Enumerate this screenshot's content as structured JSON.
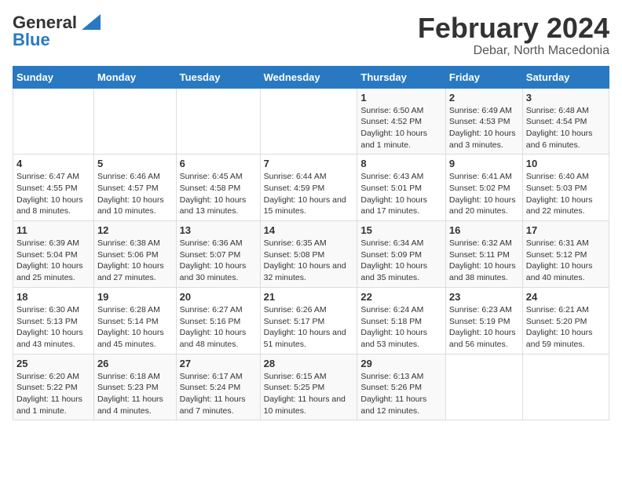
{
  "header": {
    "logo_general": "General",
    "logo_blue": "Blue",
    "main_title": "February 2024",
    "sub_title": "Debar, North Macedonia"
  },
  "calendar": {
    "days_of_week": [
      "Sunday",
      "Monday",
      "Tuesday",
      "Wednesday",
      "Thursday",
      "Friday",
      "Saturday"
    ],
    "weeks": [
      [
        {
          "day": "",
          "info": ""
        },
        {
          "day": "",
          "info": ""
        },
        {
          "day": "",
          "info": ""
        },
        {
          "day": "",
          "info": ""
        },
        {
          "day": "1",
          "info": "Sunrise: 6:50 AM\nSunset: 4:52 PM\nDaylight: 10 hours and 1 minute."
        },
        {
          "day": "2",
          "info": "Sunrise: 6:49 AM\nSunset: 4:53 PM\nDaylight: 10 hours and 3 minutes."
        },
        {
          "day": "3",
          "info": "Sunrise: 6:48 AM\nSunset: 4:54 PM\nDaylight: 10 hours and 6 minutes."
        }
      ],
      [
        {
          "day": "4",
          "info": "Sunrise: 6:47 AM\nSunset: 4:55 PM\nDaylight: 10 hours and 8 minutes."
        },
        {
          "day": "5",
          "info": "Sunrise: 6:46 AM\nSunset: 4:57 PM\nDaylight: 10 hours and 10 minutes."
        },
        {
          "day": "6",
          "info": "Sunrise: 6:45 AM\nSunset: 4:58 PM\nDaylight: 10 hours and 13 minutes."
        },
        {
          "day": "7",
          "info": "Sunrise: 6:44 AM\nSunset: 4:59 PM\nDaylight: 10 hours and 15 minutes."
        },
        {
          "day": "8",
          "info": "Sunrise: 6:43 AM\nSunset: 5:01 PM\nDaylight: 10 hours and 17 minutes."
        },
        {
          "day": "9",
          "info": "Sunrise: 6:41 AM\nSunset: 5:02 PM\nDaylight: 10 hours and 20 minutes."
        },
        {
          "day": "10",
          "info": "Sunrise: 6:40 AM\nSunset: 5:03 PM\nDaylight: 10 hours and 22 minutes."
        }
      ],
      [
        {
          "day": "11",
          "info": "Sunrise: 6:39 AM\nSunset: 5:04 PM\nDaylight: 10 hours and 25 minutes."
        },
        {
          "day": "12",
          "info": "Sunrise: 6:38 AM\nSunset: 5:06 PM\nDaylight: 10 hours and 27 minutes."
        },
        {
          "day": "13",
          "info": "Sunrise: 6:36 AM\nSunset: 5:07 PM\nDaylight: 10 hours and 30 minutes."
        },
        {
          "day": "14",
          "info": "Sunrise: 6:35 AM\nSunset: 5:08 PM\nDaylight: 10 hours and 32 minutes."
        },
        {
          "day": "15",
          "info": "Sunrise: 6:34 AM\nSunset: 5:09 PM\nDaylight: 10 hours and 35 minutes."
        },
        {
          "day": "16",
          "info": "Sunrise: 6:32 AM\nSunset: 5:11 PM\nDaylight: 10 hours and 38 minutes."
        },
        {
          "day": "17",
          "info": "Sunrise: 6:31 AM\nSunset: 5:12 PM\nDaylight: 10 hours and 40 minutes."
        }
      ],
      [
        {
          "day": "18",
          "info": "Sunrise: 6:30 AM\nSunset: 5:13 PM\nDaylight: 10 hours and 43 minutes."
        },
        {
          "day": "19",
          "info": "Sunrise: 6:28 AM\nSunset: 5:14 PM\nDaylight: 10 hours and 45 minutes."
        },
        {
          "day": "20",
          "info": "Sunrise: 6:27 AM\nSunset: 5:16 PM\nDaylight: 10 hours and 48 minutes."
        },
        {
          "day": "21",
          "info": "Sunrise: 6:26 AM\nSunset: 5:17 PM\nDaylight: 10 hours and 51 minutes."
        },
        {
          "day": "22",
          "info": "Sunrise: 6:24 AM\nSunset: 5:18 PM\nDaylight: 10 hours and 53 minutes."
        },
        {
          "day": "23",
          "info": "Sunrise: 6:23 AM\nSunset: 5:19 PM\nDaylight: 10 hours and 56 minutes."
        },
        {
          "day": "24",
          "info": "Sunrise: 6:21 AM\nSunset: 5:20 PM\nDaylight: 10 hours and 59 minutes."
        }
      ],
      [
        {
          "day": "25",
          "info": "Sunrise: 6:20 AM\nSunset: 5:22 PM\nDaylight: 11 hours and 1 minute."
        },
        {
          "day": "26",
          "info": "Sunrise: 6:18 AM\nSunset: 5:23 PM\nDaylight: 11 hours and 4 minutes."
        },
        {
          "day": "27",
          "info": "Sunrise: 6:17 AM\nSunset: 5:24 PM\nDaylight: 11 hours and 7 minutes."
        },
        {
          "day": "28",
          "info": "Sunrise: 6:15 AM\nSunset: 5:25 PM\nDaylight: 11 hours and 10 minutes."
        },
        {
          "day": "29",
          "info": "Sunrise: 6:13 AM\nSunset: 5:26 PM\nDaylight: 11 hours and 12 minutes."
        },
        {
          "day": "",
          "info": ""
        },
        {
          "day": "",
          "info": ""
        }
      ]
    ]
  }
}
